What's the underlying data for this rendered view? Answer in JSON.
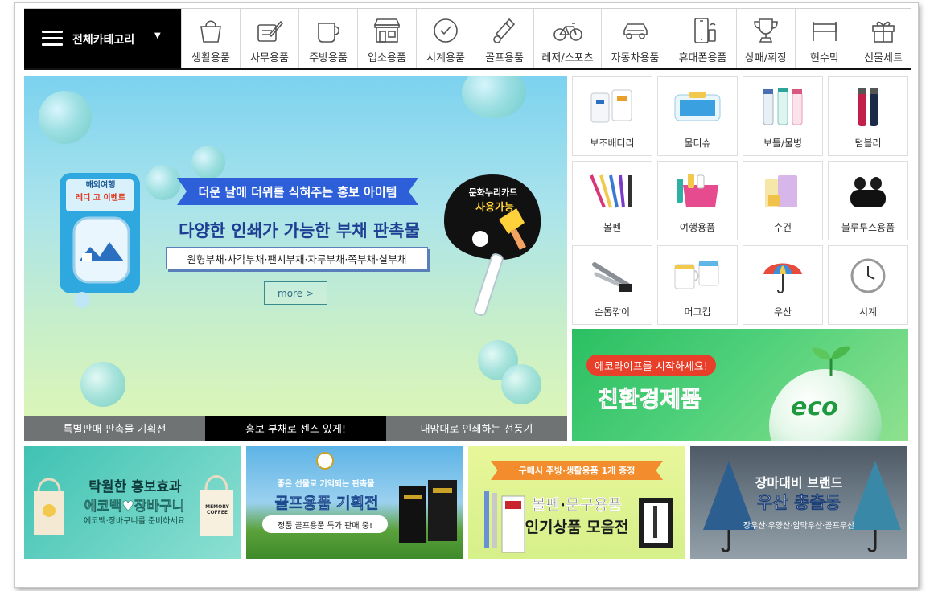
{
  "category_bar": {
    "all_label": "전체카테고리",
    "items": [
      {
        "label": "생활용품",
        "icon": "shopping-bag-icon"
      },
      {
        "label": "사무용품",
        "icon": "pen-writing-icon"
      },
      {
        "label": "주방용품",
        "icon": "mug-icon"
      },
      {
        "label": "업소용품",
        "icon": "storefront-icon"
      },
      {
        "label": "시계용품",
        "icon": "clock-icon"
      },
      {
        "label": "골프용품",
        "icon": "golf-club-icon"
      },
      {
        "label": "레저/스포츠",
        "icon": "bicycle-icon"
      },
      {
        "label": "자동차용품",
        "icon": "car-icon"
      },
      {
        "label": "휴대폰용품",
        "icon": "smartphone-icon"
      },
      {
        "label": "상패/휘장",
        "icon": "trophy-icon"
      },
      {
        "label": "현수막",
        "icon": "banner-icon"
      },
      {
        "label": "선물세트",
        "icon": "gift-box-icon"
      }
    ]
  },
  "hero": {
    "ribbon": "더운 날에 더위를 식혀주는 홍보 아이템",
    "title": "다양한 인쇄가 가능한 부채 판촉물",
    "subtitle": "원형부채·사각부채·팬시부채·자루부채·쪽부채·살부채",
    "more": "more >",
    "left_fan": {
      "line1": "해외여행",
      "line2": "레디 고 이벤트"
    },
    "right_fan": {
      "line1": "문화누리카드",
      "line2": "사용가능"
    },
    "tabs": [
      "특별판매 판촉물 기획전",
      "홍보 부채로 센스 있게!",
      "내맘대로 인쇄하는 선풍기"
    ]
  },
  "products": [
    {
      "label": "보조배터리"
    },
    {
      "label": "물티슈"
    },
    {
      "label": "보틀/물병"
    },
    {
      "label": "텀블러"
    },
    {
      "label": "볼펜"
    },
    {
      "label": "여행용품"
    },
    {
      "label": "수건"
    },
    {
      "label": "블루투스용품"
    },
    {
      "label": "손톱깎이"
    },
    {
      "label": "머그컵"
    },
    {
      "label": "우산"
    },
    {
      "label": "시계"
    }
  ],
  "eco_banner": {
    "tag": "에코라이프를 시작하세요!",
    "title": "친환경제품",
    "globe_word": "eco"
  },
  "promos": [
    {
      "line1": "탁월한 홍보효과",
      "line2": "에코백♥장바구니",
      "line3": "에코백·장바구니를 준비하세요",
      "bag_text": "MEMORY COFFEE"
    },
    {
      "line1": "좋은 선물로 기억되는 판촉물",
      "line2": "골프용품 기획전",
      "line3": "정품 골프용품 특가 판매 중!"
    },
    {
      "line1": "구매시 주방·생활용품 1개 증정",
      "line2": "볼펜·문구용품",
      "line3": "인기상품 모음전"
    },
    {
      "line1": "장마대비 브랜드",
      "line2": "우산 총출동",
      "line3": "장우산·우양산·암막우산·골프우산"
    }
  ],
  "colors": {
    "hero_tab_active": "#000000",
    "hero_tab": "#6f7374",
    "ribbon": "#2c5fd8",
    "eco_green": "#2bbf62",
    "eco_tag": "#e83f2a"
  }
}
